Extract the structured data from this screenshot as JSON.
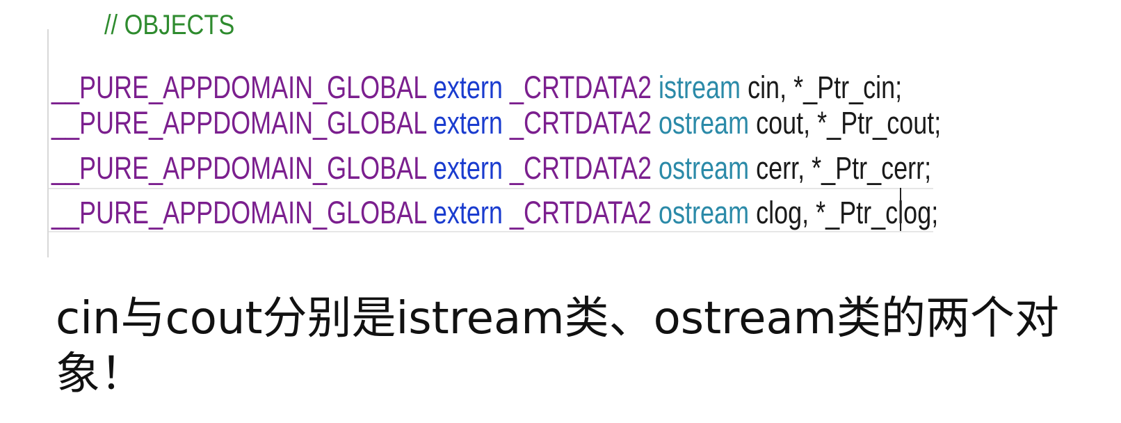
{
  "editor": {
    "comment": "// OBJECTS",
    "lines": [
      {
        "macro": "__PURE_APPDOMAIN_GLOBAL",
        "keyword": "extern",
        "macro2": "_CRTDATA2",
        "type": "istream",
        "rest": "cin, *_Ptr_cin;"
      },
      {
        "macro": "__PURE_APPDOMAIN_GLOBAL",
        "keyword": "extern",
        "macro2": "_CRTDATA2",
        "type": "ostream",
        "rest": "cout, *_Ptr_cout;"
      },
      {
        "macro": "__PURE_APPDOMAIN_GLOBAL",
        "keyword": "extern",
        "macro2": "_CRTDATA2",
        "type": "ostream",
        "rest": "cerr, *_Ptr_cerr;"
      },
      {
        "macro": "__PURE_APPDOMAIN_GLOBAL",
        "keyword": "extern",
        "macro2": "_CRTDATA2",
        "type": "ostream",
        "rest": "clog, *_Ptr_clog;"
      }
    ]
  },
  "caption": {
    "text": "cin与cout分别是istream类、ostream类的两个对象！"
  },
  "colors": {
    "macro": "#7b1f8e",
    "keyword": "#1a3ccf",
    "type": "#2b8aa8",
    "comment": "#2e8b2e",
    "text": "#1a1a1a"
  }
}
